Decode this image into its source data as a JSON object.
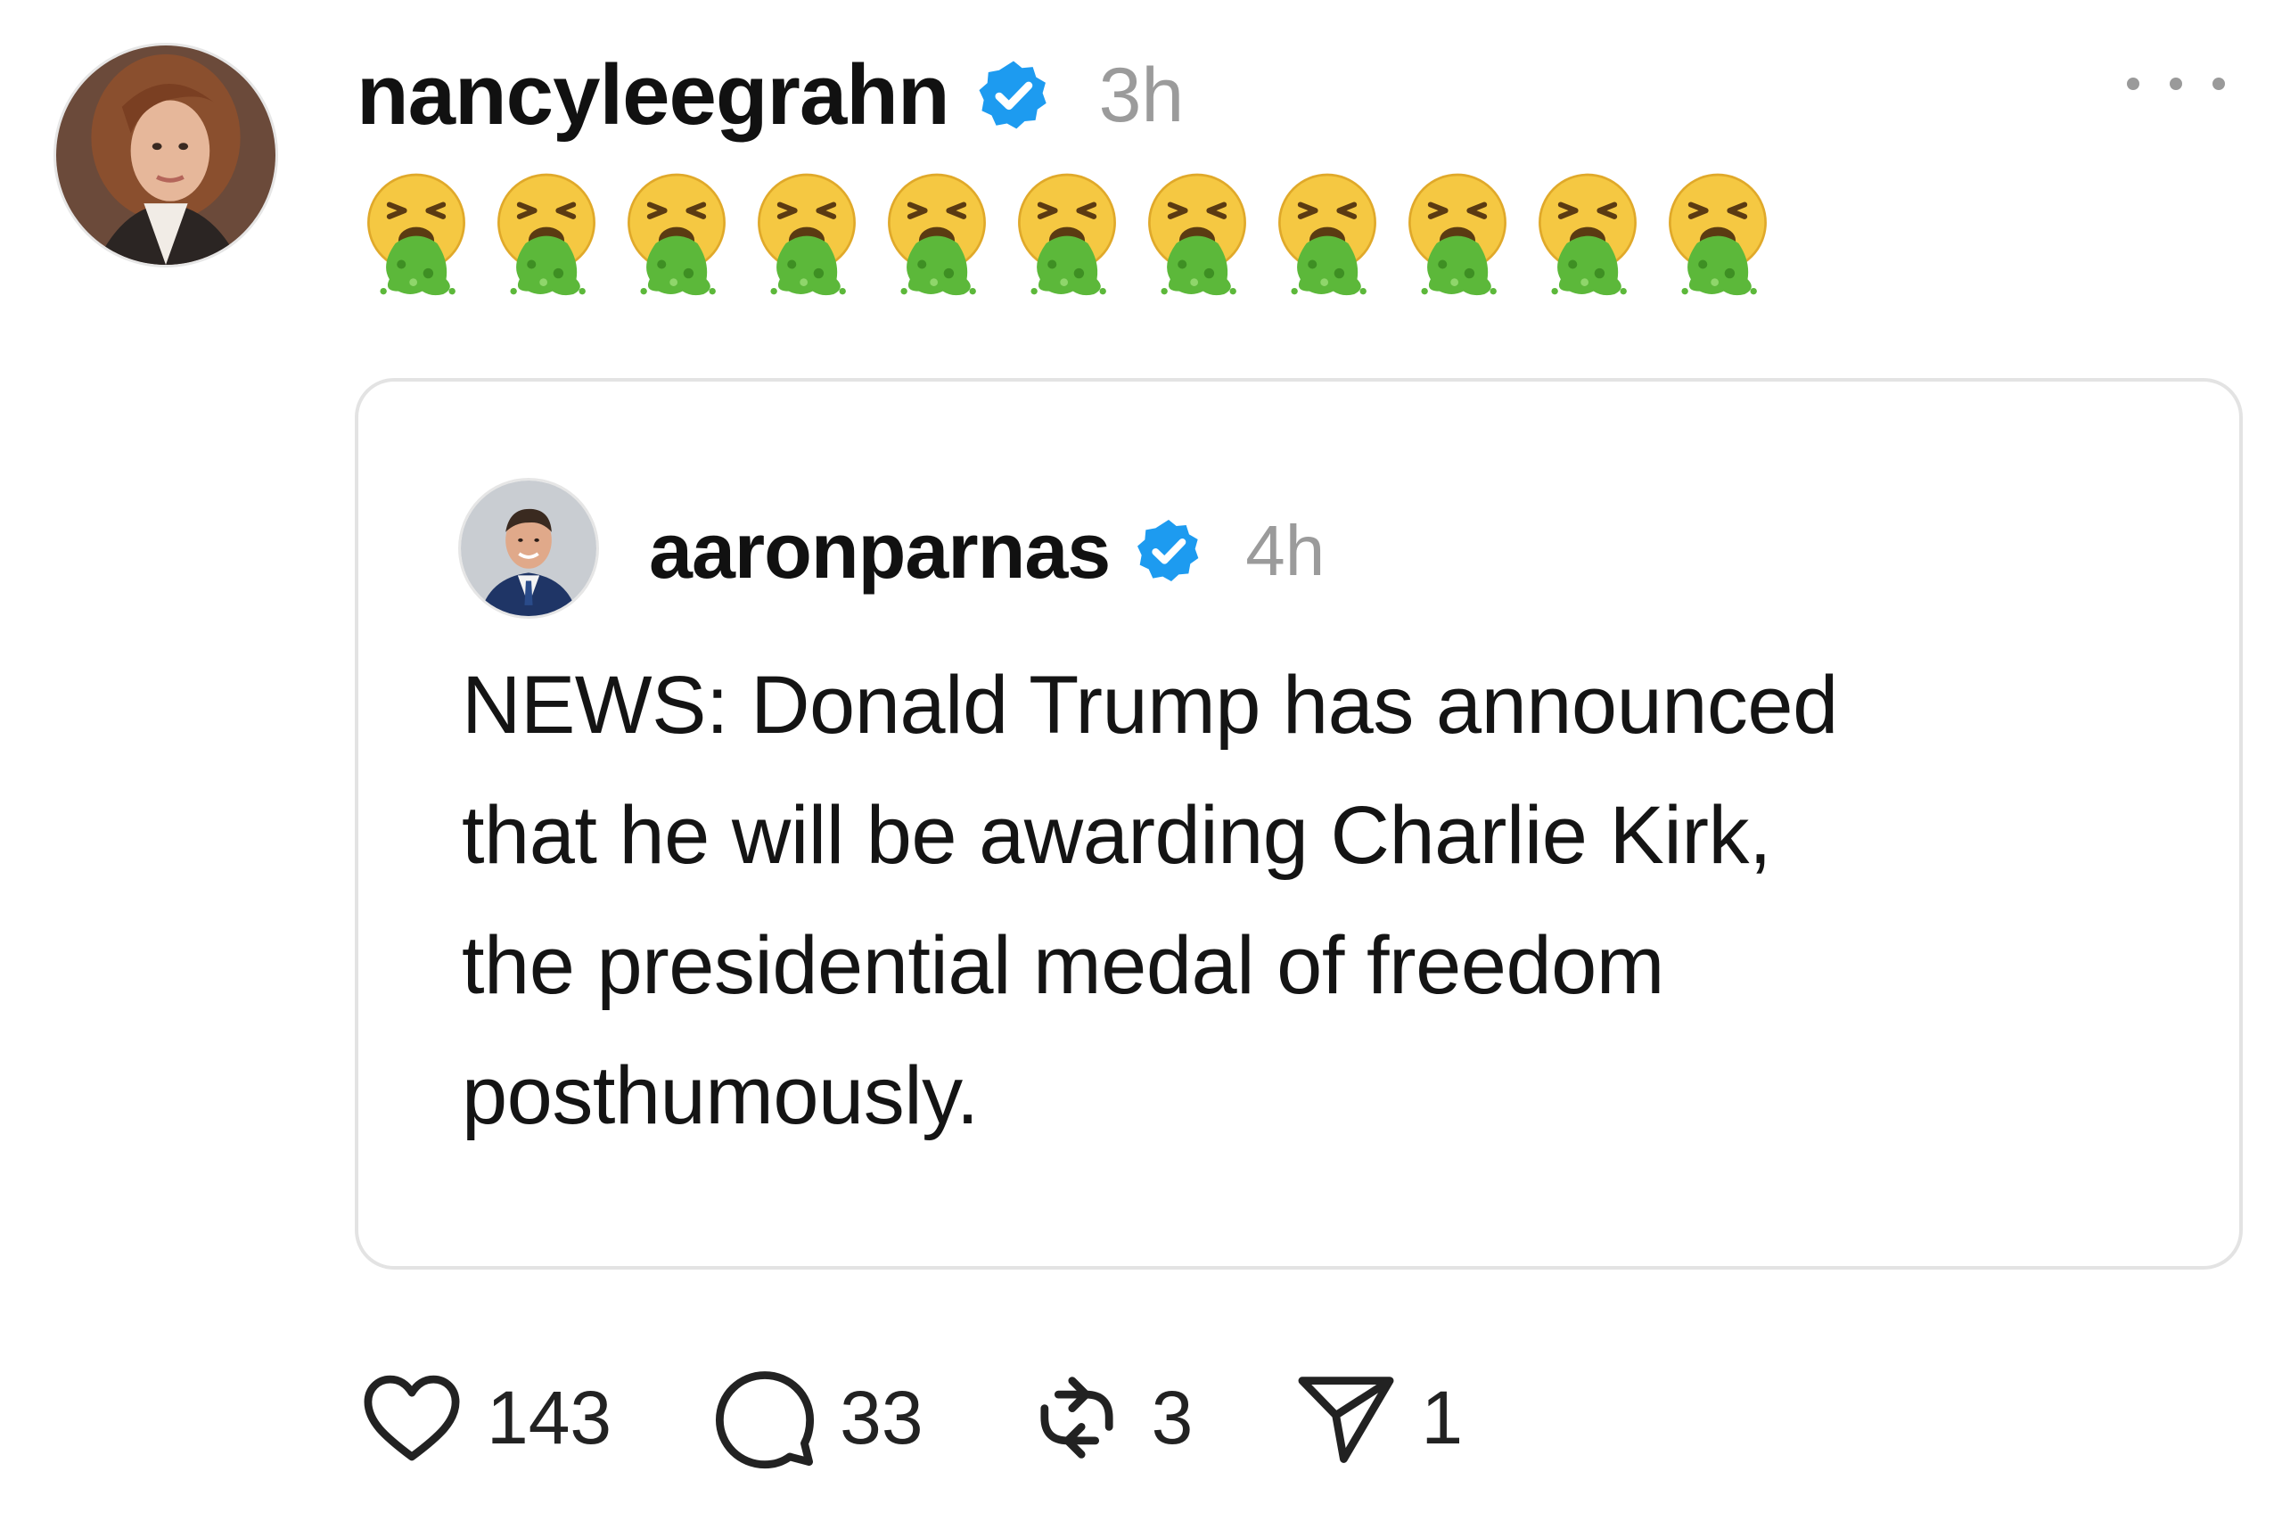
{
  "post": {
    "author": "nancyleegrahn",
    "time": "3h",
    "avatar_icon": "profile-photo-woman",
    "verified_icon": "verified-badge-icon",
    "emoji_text": "🤮🤮🤮🤮🤮🤮🤮🤮🤮🤮🤮",
    "emoji_count": 11,
    "emoji_icon": "vomiting-face-emoji"
  },
  "quote": {
    "author": "aaronparnas",
    "time": "4h",
    "avatar_icon": "profile-photo-man",
    "lines": [
      "NEWS: Donald Trump has announced",
      "that he will be awarding Charlie Kirk,",
      "the presidential medal of freedom",
      "posthumously."
    ]
  },
  "actions": {
    "likes": "143",
    "replies": "33",
    "reposts": "3",
    "shares": "1"
  },
  "colors": {
    "verified": "#1d9bf0",
    "muted": "#9b9b9b",
    "border": "#e3e3e3",
    "emoji_face": "#f5c842",
    "emoji_vomit": "#5cb83a"
  }
}
